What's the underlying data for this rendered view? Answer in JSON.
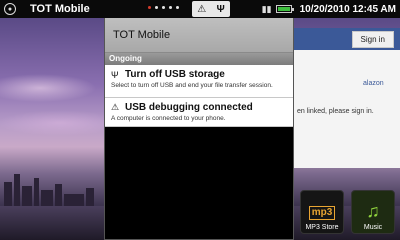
{
  "statusbar": {
    "app_title": "TOT Mobile",
    "datetime": "10/20/2010 12:45 AM",
    "menu_icon": "circle-menu-icon",
    "notif_icons": [
      "warning-icon",
      "usb-icon"
    ],
    "battery_level": 1.0,
    "accent_dot_color": "#d43c2c"
  },
  "panel": {
    "title": "TOT Mobile",
    "section": "Ongoing",
    "notifications": [
      {
        "icon": "usb-icon",
        "title": "Turn off USB storage",
        "desc": "Select to turn off USB and end your file transfer session."
      },
      {
        "icon": "warning-icon",
        "title": "USB debugging connected",
        "desc": "A computer is connected to your phone."
      }
    ]
  },
  "background_app": {
    "signin_label": "Sign in",
    "body_text": "en linked, please sign in.",
    "link_text": "alazon",
    "brand_color": "#3b5998"
  },
  "dock": {
    "items": [
      {
        "label": "MP3 Store",
        "icon": "amazon-mp3-icon"
      },
      {
        "label": "Music",
        "icon": "music-note-icon"
      }
    ]
  }
}
